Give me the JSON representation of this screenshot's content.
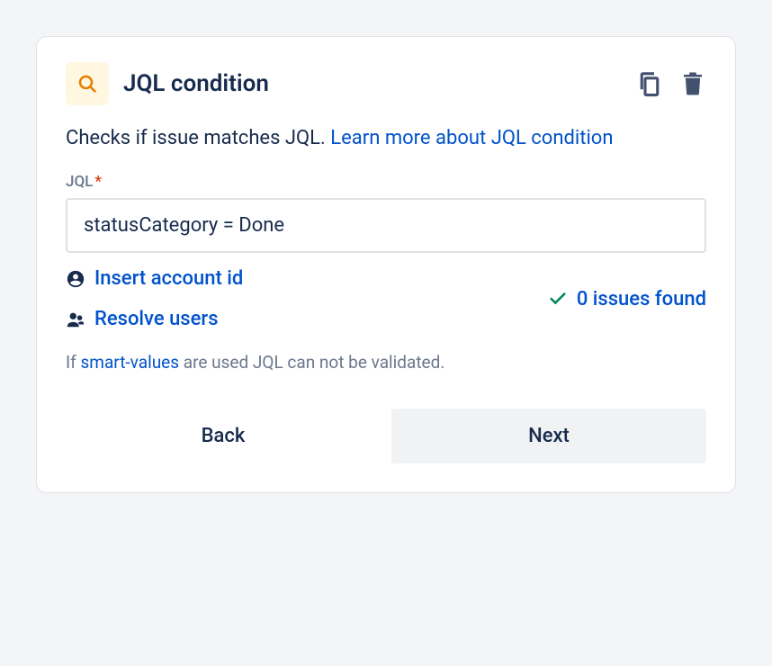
{
  "header": {
    "title": "JQL condition"
  },
  "description": {
    "prefix": "Checks if issue matches JQL. ",
    "link": "Learn more about JQL condition"
  },
  "field": {
    "label": "JQL",
    "required": "*",
    "value": "statusCategory = Done"
  },
  "links": {
    "insert_account": "Insert account id",
    "resolve_users": "Resolve users"
  },
  "validation": {
    "result": "0 issues found"
  },
  "note": {
    "prefix": "If ",
    "link": "smart-values",
    "suffix": " are used JQL can not be validated."
  },
  "buttons": {
    "back": "Back",
    "next": "Next"
  }
}
